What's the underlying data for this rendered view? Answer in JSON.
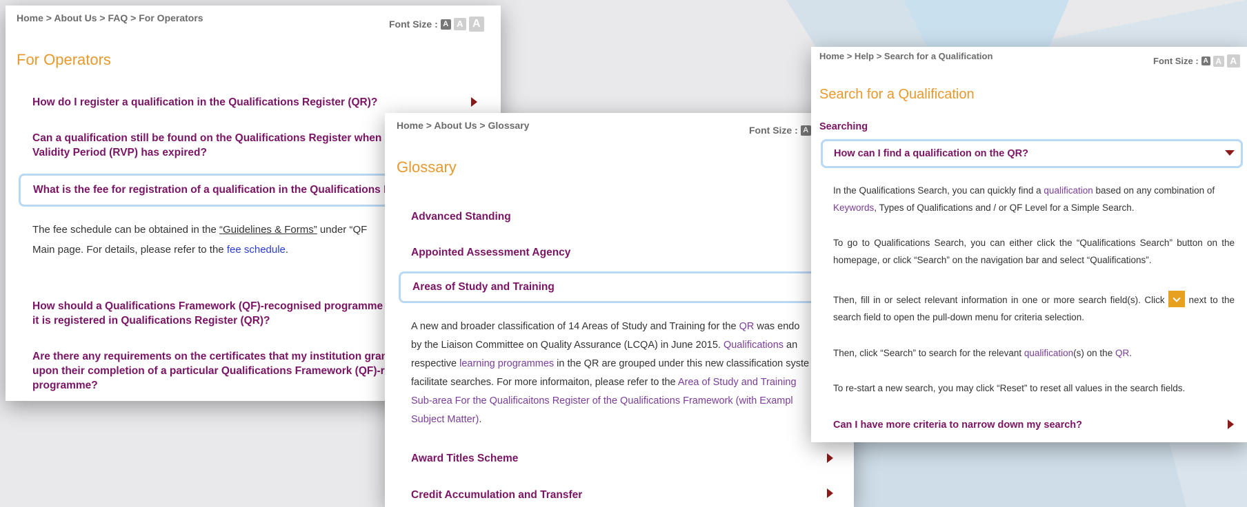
{
  "colors": {
    "accent_orange": "#e69a2e",
    "question_purple": "#7a1464",
    "link_purple": "#7a3d99",
    "link_blue": "#2a3bd6",
    "active_border": "#b9d8f5",
    "arrow": "#8b1a1a"
  },
  "operators": {
    "breadcrumb": "Home > About Us > FAQ > For Operators",
    "font_size_label": "Font Size :",
    "title": "For Operators",
    "q1": "How do I register a qualification in the Qualifications Register (QR)?",
    "q2": "Can a qualification still be found on the Qualifications Register when i",
    "q2b": "Validity Period (RVP) has expired?",
    "q3": "What is the fee for registration of a qualification in the Qualifications R",
    "ans_1": "The fee schedule can be obtained in the ",
    "ans_link1": "“Guidelines & Forms”",
    "ans_2": " under “QF",
    "ans_3": "Main page. For details, please refer to the ",
    "ans_link2": "fee schedule",
    "ans_4": ".",
    "q4": "How should a Qualifications Framework (QF)-recognised programme l",
    "q4b": "it is registered in Qualifications Register (QR)?",
    "q5": "Are there any requirements on the certificates that my institution gran",
    "q5b": "upon their completion of a particular Qualifications Framework (QF)-re",
    "q5c": "programme?"
  },
  "glossary": {
    "breadcrumb": "Home > About Us > Glossary",
    "font_size_label": "Font Size :",
    "title": "Glossary",
    "items": [
      "Advanced Standing",
      "Appointed Assessment Agency",
      "Areas of Study and Training",
      "Award Titles Scheme",
      "Credit Accumulation and Transfer"
    ],
    "p1": "A new and broader classification of 14 Areas of Study and Training for the ",
    "p_qr": "QR",
    "p2": " was endo",
    "p3": "by the Liaison Committee on Quality Assurance (LCQA) in June 2015. ",
    "p_qual": "Qualifications",
    "p4": " an",
    "p5": "respective ",
    "p_lp": "learning programmes",
    "p6": " in the QR are grouped under this new classification syste",
    "p7": "facilitate searches. For more informaiton, please refer to the ",
    "p_area": "Area of Study and Training",
    "p8": "Sub-area For the Qualificaitons Register of the Qualifications Framework (with Exampl",
    "p9": "Subject Matter)",
    "p10": "."
  },
  "search": {
    "breadcrumb": "Home > Help > Search for a Qualification",
    "font_size_label": "Font Size :",
    "title": "Search for a Qualification",
    "section": "Searching",
    "q_active": "How can I find a qualification on the QR?",
    "a1_1": "In the Qualifications Search, you can quickly find a ",
    "a1_link": "qualification",
    "a1_2": " based on any combination of",
    "a1_link2": "Keywords",
    "a1_3": ", Types of Qualifications and / or QF Level for a Simple Search.",
    "a2": "To go to Qualifications Search, you can either click the “Qualifications Search” button on the homepage, or click “Search” on the navigation bar and select “Qualifications”.",
    "a3_1": "Then, fill in or select relevant information in one or more search field(s). Click ",
    "a3_2": " next to the search field to open the pull-down menu for criteria selection.",
    "a4_1": "Then, click “Search” to search for the relevant ",
    "a4_link": "qualification",
    "a4_2": "(s) on the ",
    "a4_link2": "QR",
    "a4_3": ".",
    "a5": "To re-start a new search, you may click “Reset” to reset all values in the search fields.",
    "q_next": "Can I have more criteria to narrow down my search?"
  },
  "font_size_buttons": [
    "A",
    "A",
    "A"
  ],
  "icons": [
    "arrow-right-icon",
    "arrow-down-icon",
    "dropdown-chevron-icon"
  ]
}
